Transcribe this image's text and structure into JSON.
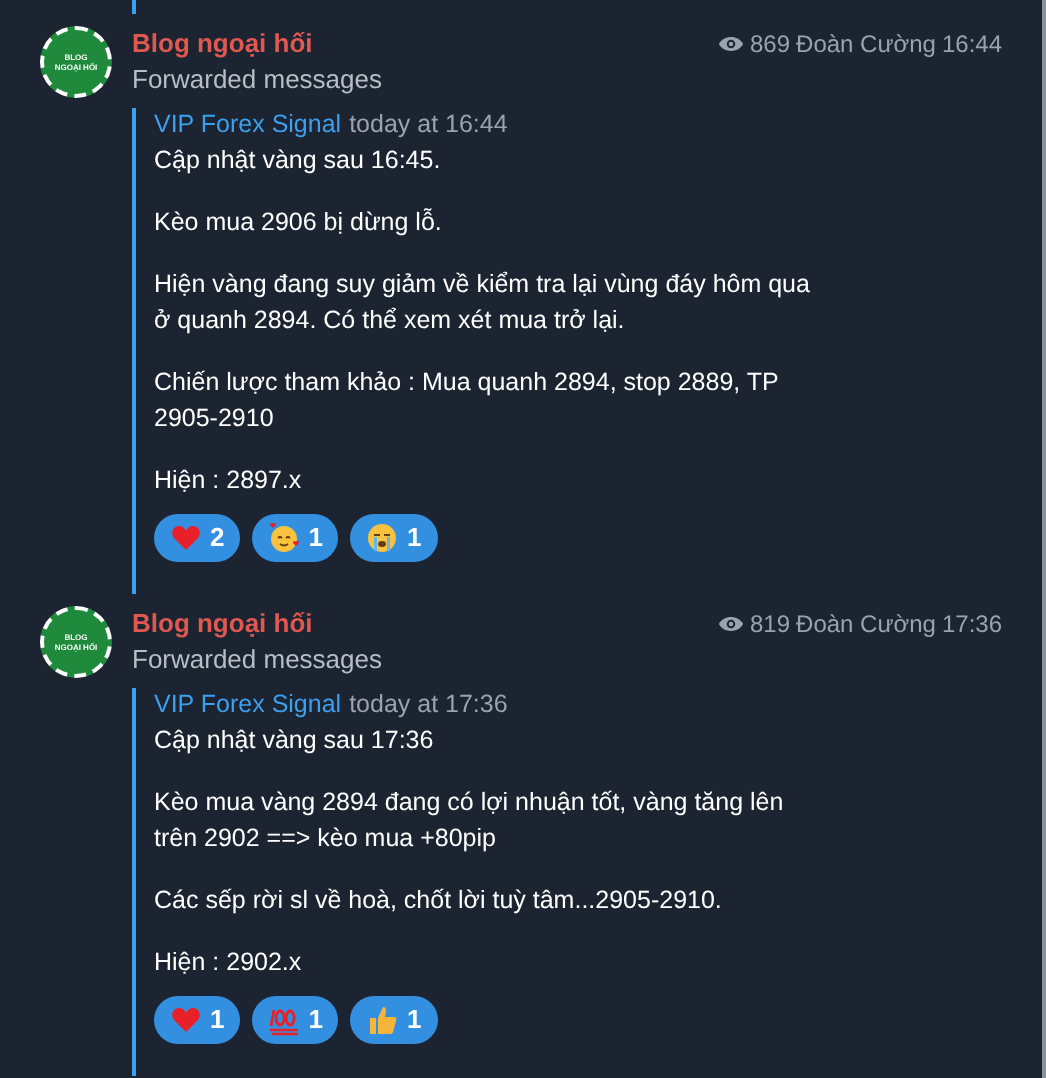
{
  "messages": [
    {
      "avatar": {
        "lines": [
          "BLOG",
          "NGOẠI HỐI"
        ]
      },
      "sender": "Blog ngoại hối",
      "subtitle": "Forwarded messages",
      "views": "869",
      "author": "Đoàn Cường",
      "time": "16:44",
      "forward": {
        "source": "VIP Forex Signal",
        "time": "today at 16:44",
        "paragraphs": [
          [
            "Cập nhật vàng sau 16:45."
          ],
          [
            "Kèo mua 2906 bị dừng lỗ."
          ],
          [
            "Hiện vàng đang suy giảm về kiểm tra lại vùng đáy hôm qua",
            "ở quanh 2894. Có thể xem xét mua trở lại."
          ],
          [
            "Chiến lược tham khảo : Mua quanh 2894, stop 2889, TP",
            "2905-2910"
          ],
          [
            "Hiện : 2897.x"
          ]
        ]
      },
      "reactions": [
        {
          "kind": "heart",
          "count": "2"
        },
        {
          "kind": "hearts-face",
          "count": "1"
        },
        {
          "kind": "crying",
          "count": "1"
        }
      ]
    },
    {
      "avatar": {
        "lines": [
          "BLOG",
          "NGOẠI HỐI"
        ]
      },
      "sender": "Blog ngoại hối",
      "subtitle": "Forwarded messages",
      "views": "819",
      "author": "Đoàn Cường",
      "time": "17:36",
      "forward": {
        "source": "VIP Forex Signal",
        "time": "today at 17:36",
        "paragraphs": [
          [
            "Cập nhật vàng sau 17:36"
          ],
          [
            "Kèo mua vàng 2894 đang có lợi nhuận tốt, vàng tăng lên",
            "trên 2902 ==> kèo mua +80pip"
          ],
          [
            "Các sếp rời sl về hoà, chốt lời tuỳ tâm...2905-2910."
          ],
          [
            "Hiện : 2902.x"
          ]
        ]
      },
      "reactions": [
        {
          "kind": "heart",
          "count": "1"
        },
        {
          "kind": "hundred",
          "count": "1"
        },
        {
          "kind": "thumbs-up",
          "count": "1"
        }
      ]
    }
  ]
}
